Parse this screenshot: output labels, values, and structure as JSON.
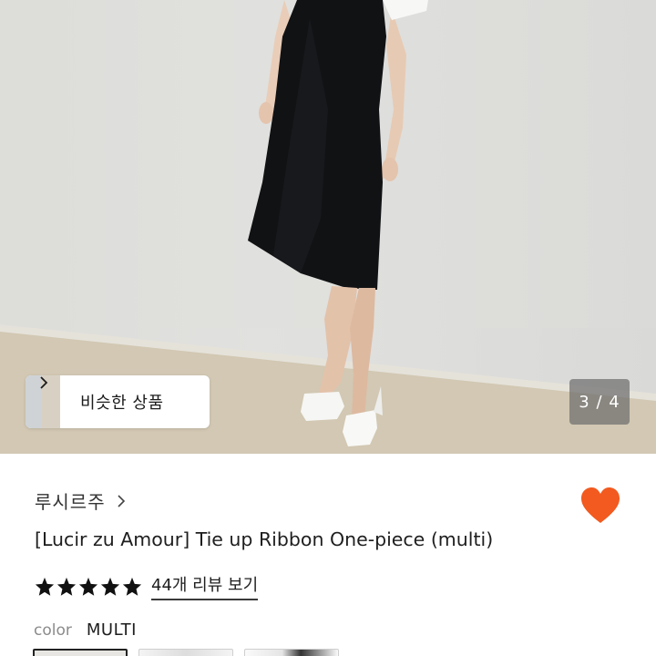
{
  "gallery": {
    "image_alt": "Model wearing black one-piece dress with white heels",
    "similar_label": "비슷한 상품",
    "counter": "3 / 4"
  },
  "product": {
    "brand": "루시르주",
    "title": "[Lucir zu Amour] Tie up Ribbon One-piece (multi)",
    "rating": 5,
    "review_link": "44개 리뷰 보기",
    "color_label": "color",
    "color_value": "MULTI",
    "color_options": 3
  },
  "colors": {
    "heart": "#F25A1F",
    "star": "#111111"
  },
  "icons": [
    "chevron-right-icon",
    "heart-icon",
    "star-icon"
  ]
}
